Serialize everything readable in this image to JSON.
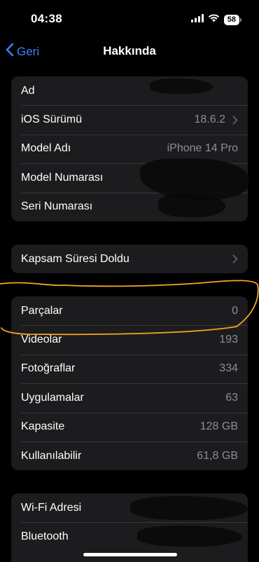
{
  "status_bar": {
    "time": "04:38",
    "battery": "58"
  },
  "nav": {
    "back_label": "Geri",
    "title": "Hakkında"
  },
  "group1": [
    {
      "label": "Ad",
      "value": "",
      "chevron": false
    },
    {
      "label": "iOS Sürümü",
      "value": "18.6.2",
      "chevron": true
    },
    {
      "label": "Model Adı",
      "value": "iPhone 14 Pro",
      "chevron": false
    },
    {
      "label": "Model Numarası",
      "value": "",
      "chevron": false
    },
    {
      "label": "Seri Numarası",
      "value": "",
      "chevron": false
    }
  ],
  "group2": [
    {
      "label": "Kapsam Süresi Doldu",
      "value": "",
      "chevron": true
    }
  ],
  "group3": [
    {
      "label": "Parçalar",
      "value": "0"
    },
    {
      "label": "Videolar",
      "value": "193"
    },
    {
      "label": "Fotoğraflar",
      "value": "334"
    },
    {
      "label": "Uygulamalar",
      "value": "63"
    },
    {
      "label": "Kapasite",
      "value": "128 GB"
    },
    {
      "label": "Kullanılabilir",
      "value": "61,8 GB"
    }
  ],
  "group4": [
    {
      "label": "Wi-Fi Adresi",
      "value": ""
    },
    {
      "label": "Bluetooth",
      "value": ""
    }
  ],
  "colors": {
    "accent": "#3b82f6",
    "highlight_stroke": "#f5a623",
    "cell_bg": "#1c1c1e"
  }
}
